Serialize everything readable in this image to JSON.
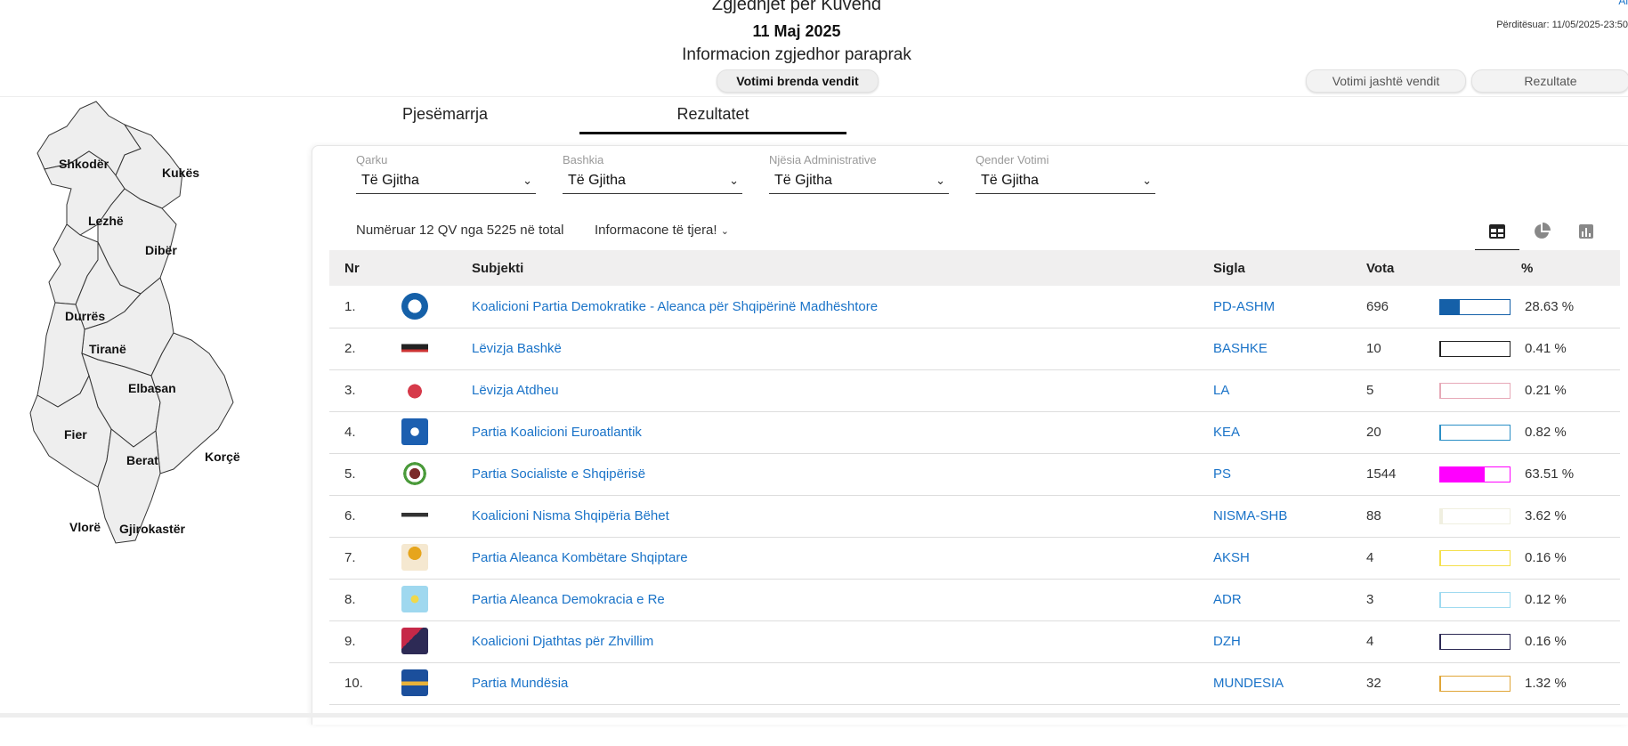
{
  "header": {
    "title": "Zgjedhjet për Kuvend",
    "date": "11 Maj 2025",
    "subtitle": "Informacion zgjedhor paraprak",
    "updated": "Përditësuar: 11/05/2025-23:50",
    "corner_link": "Al",
    "buttons": {
      "inside": "Votimi brenda vendit",
      "abroad": "Votimi jashtë vendit",
      "results": "Rezultate"
    }
  },
  "map": {
    "regions": [
      "Shkodër",
      "Kukës",
      "Lezhë",
      "Dibër",
      "Durrës",
      "Tiranë",
      "Elbasan",
      "Fier",
      "Berat",
      "Korçë",
      "Vlorë",
      "Gjirokastër"
    ]
  },
  "tabs": {
    "participation": "Pjesëmarrja",
    "results": "Rezultatet"
  },
  "filters": [
    {
      "label": "Qarku",
      "value": "Të Gjitha"
    },
    {
      "label": "Bashkia",
      "value": "Të Gjitha"
    },
    {
      "label": "Njësia Administrative",
      "value": "Të Gjitha"
    },
    {
      "label": "Qender Votimi",
      "value": "Të Gjitha"
    }
  ],
  "summary": {
    "counted": "Numëruar 12 QV nga 5225 në total",
    "more_info": "Informacone të tjera!"
  },
  "icons": {
    "table": "table-icon",
    "pie": "pie-chart-icon",
    "bar": "bar-chart-icon"
  },
  "table": {
    "headers": {
      "nr": "Nr",
      "subject": "Subjekti",
      "acronym": "Sigla",
      "votes": "Vota",
      "percent": "%"
    },
    "rows": [
      {
        "nr": "1.",
        "name": "Koalicioni Partia Demokratike - Aleanca për Shqipërinë Madhështore",
        "sigla": "PD-ASHM",
        "votes": "696",
        "pct": "28.63 %",
        "share": 28.63,
        "color": "#1560a8"
      },
      {
        "nr": "2.",
        "name": "Lëvizja Bashkë",
        "sigla": "BASHKE",
        "votes": "10",
        "pct": "0.41 %",
        "share": 0.41,
        "color": "#222222"
      },
      {
        "nr": "3.",
        "name": "Lëvizja Atdheu",
        "sigla": "LA",
        "votes": "5",
        "pct": "0.21 %",
        "share": 0.21,
        "color": "#e7a9b8"
      },
      {
        "nr": "4.",
        "name": "Partia Koalicioni Euroatlantik",
        "sigla": "KEA",
        "votes": "20",
        "pct": "0.82 %",
        "share": 0.82,
        "color": "#2b8fc6"
      },
      {
        "nr": "5.",
        "name": "Partia Socialiste e Shqipërisë",
        "sigla": "PS",
        "votes": "1544",
        "pct": "63.51 %",
        "share": 63.51,
        "color": "#ff00ff"
      },
      {
        "nr": "6.",
        "name": "Koalicioni Nisma Shqipëria Bëhet",
        "sigla": "NISMA-SHB",
        "votes": "88",
        "pct": "3.62 %",
        "share": 3.62,
        "color": "#f0efe0"
      },
      {
        "nr": "7.",
        "name": "Partia Aleanca Kombëtare Shqiptare",
        "sigla": "AKSH",
        "votes": "4",
        "pct": "0.16 %",
        "share": 0.16,
        "color": "#f4e04d"
      },
      {
        "nr": "8.",
        "name": "Partia Aleanca Demokracia e Re",
        "sigla": "ADR",
        "votes": "3",
        "pct": "0.12 %",
        "share": 0.12,
        "color": "#9fdaf0"
      },
      {
        "nr": "9.",
        "name": "Koalicioni Djathtas për Zhvillim",
        "sigla": "DZH",
        "votes": "4",
        "pct": "0.16 %",
        "share": 0.16,
        "color": "#2d2a55"
      },
      {
        "nr": "10.",
        "name": "Partia Mundësia",
        "sigla": "MUNDESIA",
        "votes": "32",
        "pct": "1.32 %",
        "share": 1.32,
        "color": "#e0a638"
      }
    ]
  }
}
